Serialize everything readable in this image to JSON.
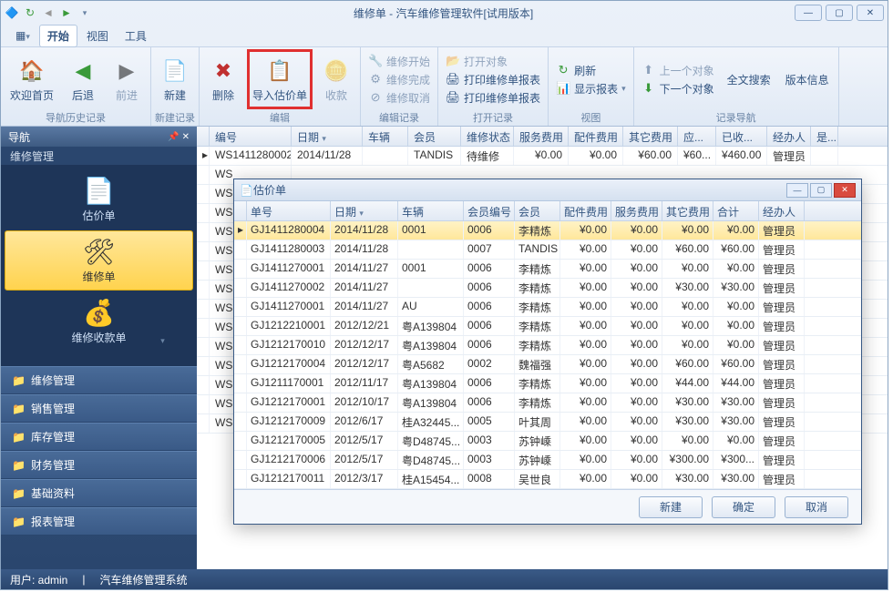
{
  "window": {
    "title": "维修单 - 汽车维修管理软件[试用版本]"
  },
  "tabs": {
    "start": "开始",
    "view": "视图",
    "tools": "工具"
  },
  "ribbon": {
    "home": "欢迎首页",
    "back": "后退",
    "forward": "前进",
    "new": "新建",
    "delete": "删除",
    "import": "导入估价单",
    "receipt": "收款",
    "repairStart": "维修开始",
    "repairDone": "维修完成",
    "repairCancel": "维修取消",
    "openObj": "打开对象",
    "printRepair": "打印维修单报表",
    "printRepairBill": "打印维修单报表",
    "refresh": "刷新",
    "showReport": "显示报表",
    "prevObj": "上一个对象",
    "nextObj": "下一个对象",
    "fullSearch": "全文搜索",
    "version": "版本信息",
    "g1": "导航历史记录",
    "g2": "新建记录",
    "g3": "编辑",
    "g4": "编辑记录",
    "g5": "打开记录",
    "g6": "视图",
    "g7": "记录导航"
  },
  "nav": {
    "header": "导航",
    "sub": "维修管理",
    "tiles": {
      "quote": "估价单",
      "repair": "维修单",
      "payment": "维修收款单"
    },
    "items": [
      "维修管理",
      "销售管理",
      "库存管理",
      "财务管理",
      "基础资料",
      "报表管理"
    ]
  },
  "mainGrid": {
    "cols": [
      "编号",
      "日期",
      "车辆",
      "会员",
      "维修状态",
      "服务费用",
      "配件费用",
      "其它费用",
      "应...",
      "已收...",
      "经办人",
      "是..."
    ],
    "row": [
      "WS1411280002",
      "2014/11/28",
      "",
      "TANDIS",
      "待维修",
      "¥0.00",
      "¥0.00",
      "¥60.00",
      "¥60...",
      "¥460.00",
      "管理员",
      ""
    ],
    "stub": "WS"
  },
  "dialog": {
    "title": "估价单",
    "cols": [
      "单号",
      "日期",
      "车辆",
      "会员编号",
      "会员",
      "配件费用",
      "服务费用",
      "其它费用",
      "合计",
      "经办人"
    ],
    "rows": [
      [
        "GJ1411280004",
        "2014/11/28",
        "0001",
        "0006",
        "李精炼",
        "¥0.00",
        "¥0.00",
        "¥0.00",
        "¥0.00",
        "管理员"
      ],
      [
        "GJ1411280003",
        "2014/11/28",
        "",
        "0007",
        "TANDIS",
        "¥0.00",
        "¥0.00",
        "¥60.00",
        "¥60.00",
        "管理员"
      ],
      [
        "GJ1411270001",
        "2014/11/27",
        "0001",
        "0006",
        "李精炼",
        "¥0.00",
        "¥0.00",
        "¥0.00",
        "¥0.00",
        "管理员"
      ],
      [
        "GJ1411270002",
        "2014/11/27",
        "",
        "0006",
        "李精炼",
        "¥0.00",
        "¥0.00",
        "¥30.00",
        "¥30.00",
        "管理员"
      ],
      [
        "GJ1411270001",
        "2014/11/27",
        "AU",
        "0006",
        "李精炼",
        "¥0.00",
        "¥0.00",
        "¥0.00",
        "¥0.00",
        "管理员"
      ],
      [
        "GJ1212210001",
        "2012/12/21",
        "粤A139804",
        "0006",
        "李精炼",
        "¥0.00",
        "¥0.00",
        "¥0.00",
        "¥0.00",
        "管理员"
      ],
      [
        "GJ1212170010",
        "2012/12/17",
        "粤A139804",
        "0006",
        "李精炼",
        "¥0.00",
        "¥0.00",
        "¥0.00",
        "¥0.00",
        "管理员"
      ],
      [
        "GJ1212170004",
        "2012/12/17",
        "粤A5682",
        "0002",
        "魏福强",
        "¥0.00",
        "¥0.00",
        "¥60.00",
        "¥60.00",
        "管理员"
      ],
      [
        "GJ1211170001",
        "2012/11/17",
        "粤A139804",
        "0006",
        "李精炼",
        "¥0.00",
        "¥0.00",
        "¥44.00",
        "¥44.00",
        "管理员"
      ],
      [
        "GJ1212170001",
        "2012/10/17",
        "粤A139804",
        "0006",
        "李精炼",
        "¥0.00",
        "¥0.00",
        "¥30.00",
        "¥30.00",
        "管理员"
      ],
      [
        "GJ1212170009",
        "2012/6/17",
        "桂A32445...",
        "0005",
        "叶其周",
        "¥0.00",
        "¥0.00",
        "¥30.00",
        "¥30.00",
        "管理员"
      ],
      [
        "GJ1212170005",
        "2012/5/17",
        "粤D48745...",
        "0003",
        "苏钟嵊",
        "¥0.00",
        "¥0.00",
        "¥0.00",
        "¥0.00",
        "管理员"
      ],
      [
        "GJ1212170006",
        "2012/5/17",
        "粤D48745...",
        "0003",
        "苏钟嵊",
        "¥0.00",
        "¥0.00",
        "¥300.00",
        "¥300...",
        "管理员"
      ],
      [
        "GJ1212170011",
        "2012/3/17",
        "桂A15454...",
        "0008",
        "吴世良",
        "¥0.00",
        "¥0.00",
        "¥30.00",
        "¥30.00",
        "管理员"
      ]
    ],
    "btns": {
      "new": "新建",
      "ok": "确定",
      "cancel": "取消"
    }
  },
  "status": {
    "user": "用户: admin",
    "sys": "汽车维修管理系统"
  }
}
